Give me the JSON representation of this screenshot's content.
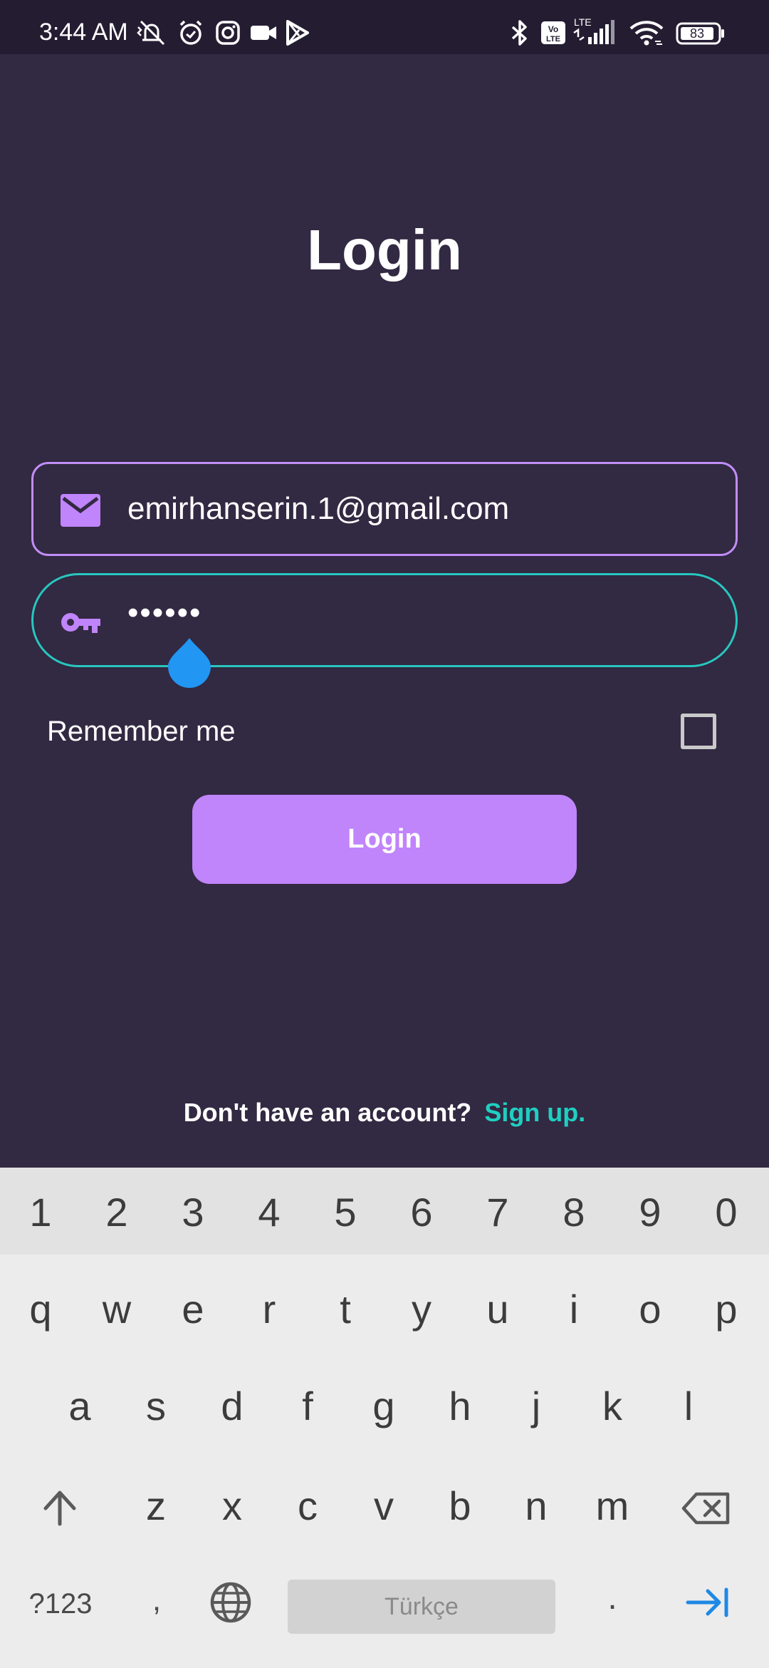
{
  "status_bar": {
    "time": "3:44 AM",
    "battery": "83",
    "network_small": "LTE",
    "volte_top": "Vo",
    "volte_bottom": "LTE"
  },
  "login": {
    "title": "Login",
    "email_value": "emirhanserin.1@gmail.com",
    "password_value": "••••••",
    "remember_label": "Remember me",
    "remember_checked": false,
    "login_button": "Login",
    "no_account_text": "Don't have an account?",
    "signup_link": "Sign up."
  },
  "icons": {
    "email": "mail-icon",
    "password": "key-icon"
  },
  "colors": {
    "background": "#322942",
    "accent_purple": "#c084fb",
    "accent_teal": "#1fcfc1",
    "cursor_handle": "#2196f3"
  },
  "keyboard": {
    "numbers": [
      "1",
      "2",
      "3",
      "4",
      "5",
      "6",
      "7",
      "8",
      "9",
      "0"
    ],
    "row1": [
      "q",
      "w",
      "e",
      "r",
      "t",
      "y",
      "u",
      "i",
      "o",
      "p"
    ],
    "row2": [
      "a",
      "s",
      "d",
      "f",
      "g",
      "h",
      "j",
      "k",
      "l"
    ],
    "row3": [
      "z",
      "x",
      "c",
      "v",
      "b",
      "n",
      "m"
    ],
    "symbols_key": "?123",
    "comma_key": ",",
    "space_label": "Türkçe",
    "period_key": "."
  }
}
